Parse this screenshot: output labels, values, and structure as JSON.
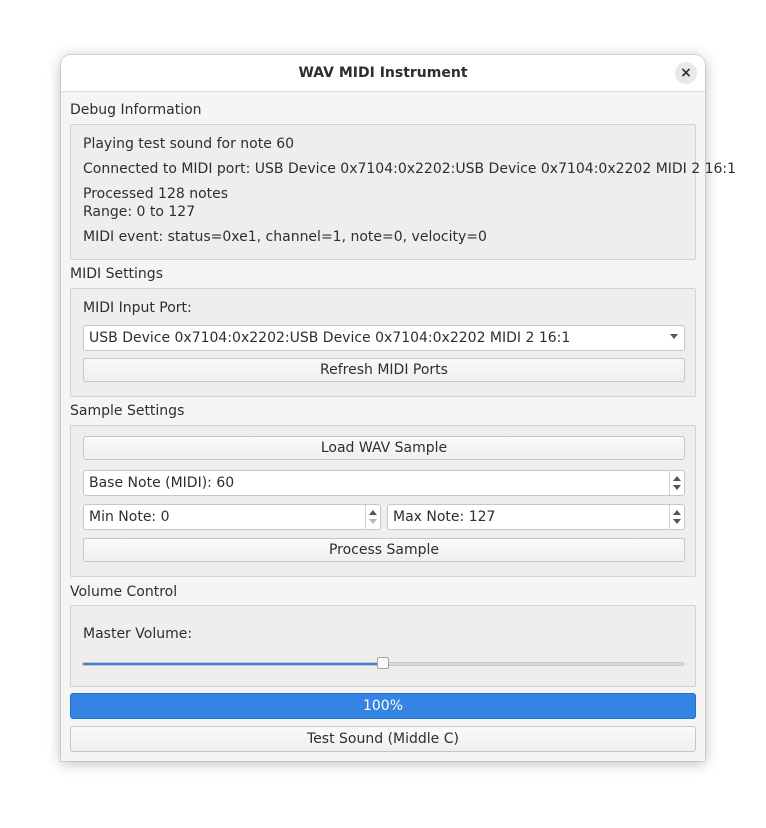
{
  "window": {
    "title": "WAV MIDI Instrument",
    "close_icon": "×"
  },
  "debug": {
    "title": "Debug Information",
    "lines": [
      "Playing test sound for note 60",
      "Connected to MIDI port: USB Device 0x7104:0x2202:USB Device 0x7104:0x2202 MIDI 2 16:1",
      "Processed 128 notes",
      "Range: 0 to 127",
      "MIDI event: status=0xe1, channel=1, note=0, velocity=0"
    ]
  },
  "midi": {
    "title": "MIDI Settings",
    "port_label": "MIDI Input Port:",
    "port_value": "USB Device 0x7104:0x2202:USB Device 0x7104:0x2202 MIDI 2 16:1",
    "refresh_label": "Refresh MIDI Ports"
  },
  "sample": {
    "title": "Sample Settings",
    "load_label": "Load WAV Sample",
    "base_note": "Base Note (MIDI): 60",
    "min_note": "Min Note: 0",
    "max_note": "Max Note: 127",
    "process_label": "Process Sample"
  },
  "volume": {
    "title": "Volume Control",
    "master_label": "Master Volume:",
    "slider_fraction": 0.5
  },
  "progress": {
    "text": "100%",
    "value": 1.0
  },
  "test_label": "Test Sound (Middle C)",
  "colors": {
    "accent": "#3584e4",
    "window_bg": "#f6f5f4",
    "group_bg": "#efeeed"
  }
}
